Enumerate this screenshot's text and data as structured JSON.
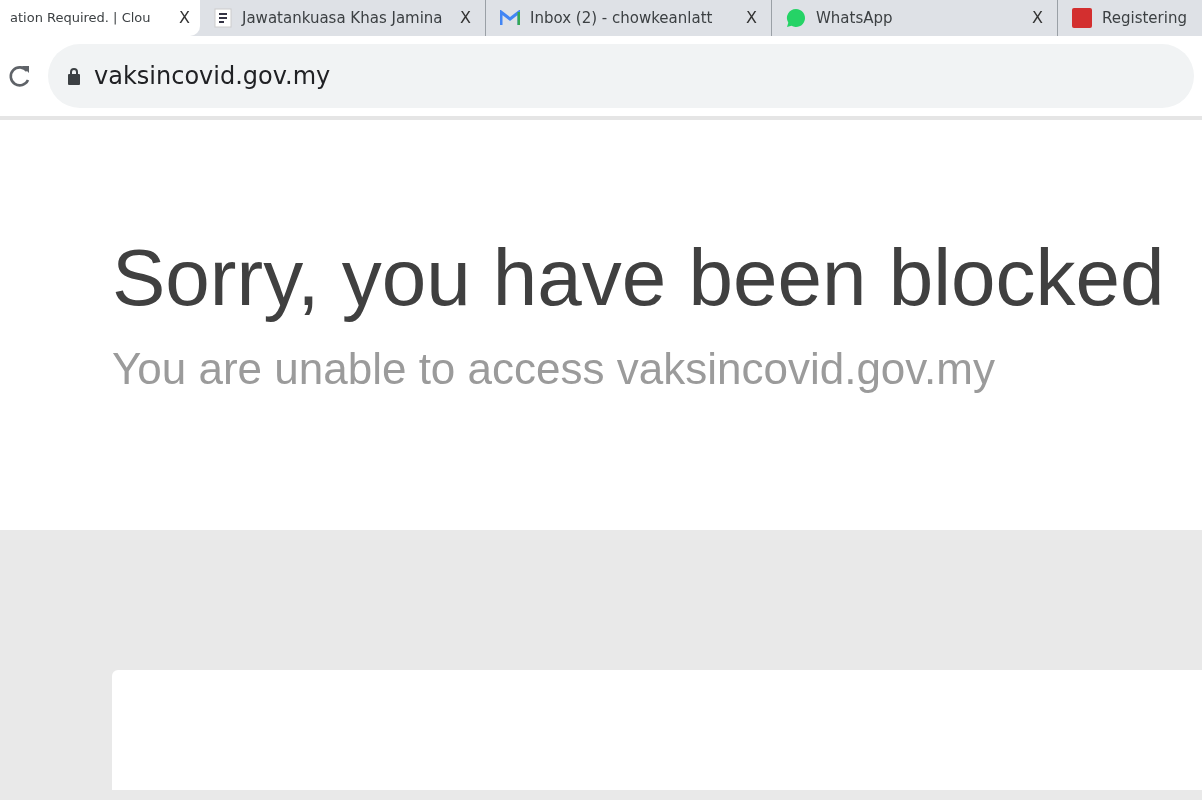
{
  "tabs": [
    {
      "title": "ation Required. | Clou",
      "selected": true,
      "close": "X"
    },
    {
      "title": "Jawatankuasa Khas Jamina",
      "selected": false,
      "close": "X"
    },
    {
      "title": "Inbox (2) - chowkeanlatt",
      "selected": false,
      "close": "X"
    },
    {
      "title": "WhatsApp",
      "selected": false,
      "close": "X"
    },
    {
      "title": "Registering",
      "selected": false
    }
  ],
  "address_bar": {
    "url": "vaksincovid.gov.my"
  },
  "page": {
    "heading": "Sorry, you have been blocked",
    "subheading": "You are unable to access vaksincovid.gov.my"
  }
}
